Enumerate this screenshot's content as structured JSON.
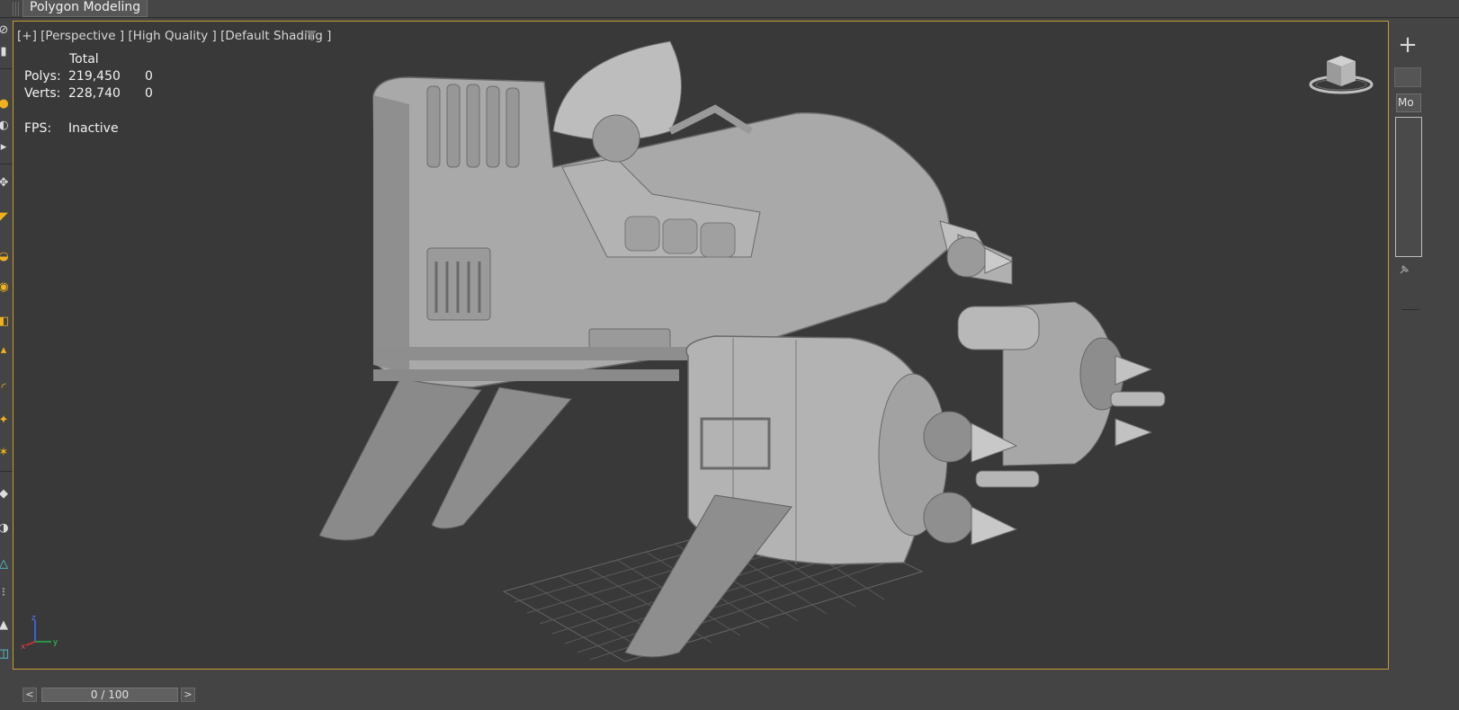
{
  "ribbon": {
    "active_tab_label": "Polygon Modeling"
  },
  "viewport": {
    "label": "[+] [Perspective ] [High Quality ] [Default Shading ]",
    "filter_icon": "funnel-icon",
    "stats": {
      "total_label": "Total",
      "polys_label": "Polys:",
      "polys_total": "219,450",
      "polys_selected": "0",
      "verts_label": "Verts:",
      "verts_total": "228,740",
      "verts_selected": "0",
      "fps_label": "FPS:",
      "fps_value": "Inactive"
    },
    "axis": {
      "x_label": "x",
      "y_label": "y",
      "z_label": "z"
    },
    "active_border_color": "#c79a35"
  },
  "command_panel": {
    "create_icon": "plus-icon",
    "modifier_dropdown_label": "Mo"
  },
  "time_slider": {
    "prev_label": "<",
    "next_label": ">",
    "position_label": "0 / 100"
  },
  "colors": {
    "viewport_bg": "#393939",
    "ui_bg": "#444444",
    "tool_accent": "#f0b11e"
  }
}
